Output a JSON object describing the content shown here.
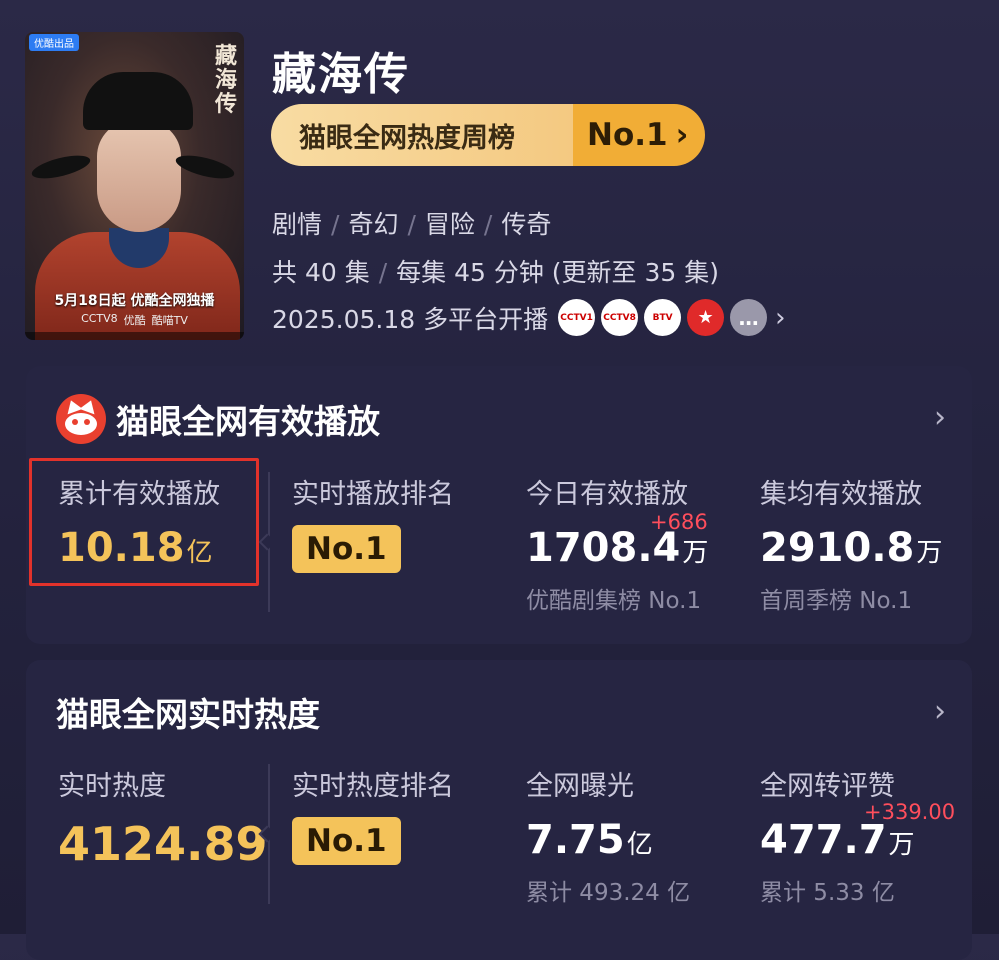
{
  "show": {
    "title": "藏海传",
    "poster": {
      "brand_tag": "优酷出品",
      "vertical_title": "藏海传",
      "date_text": "5月18日起 优酷全网独播",
      "platforms": [
        "CCTV8",
        "优酷",
        "酷喵TV"
      ]
    },
    "rank_pill": {
      "label": "猫眼全网热度周榜",
      "rank": "No.1",
      "chevron": "›"
    },
    "genres": [
      "剧情",
      "奇幻",
      "冒险",
      "传奇"
    ],
    "episodes": "共 40 集",
    "episode_detail": "每集 45 分钟 (更新至 35 集)",
    "air_date": "2025.05.18 多平台开播",
    "channel_logos": [
      "CCTV1",
      "CCTV8",
      "BTV",
      "东方",
      "…"
    ]
  },
  "card_play": {
    "title": "猫眼全网有效播放",
    "stats": [
      {
        "label": "累计有效播放",
        "value": "10.18",
        "unit": "亿"
      },
      {
        "label": "实时播放排名",
        "badge": "No.1"
      },
      {
        "label": "今日有效播放",
        "value": "1708.4",
        "unit": "万",
        "delta": "+686",
        "sub": "优酷剧集榜 No.1"
      },
      {
        "label": "集均有效播放",
        "value": "2910.8",
        "unit": "万",
        "sub": "首周季榜 No.1"
      }
    ]
  },
  "card_heat": {
    "title": "猫眼全网实时热度",
    "stats": [
      {
        "label": "实时热度",
        "value": "4124.89"
      },
      {
        "label": "实时热度排名",
        "badge": "No.1"
      },
      {
        "label": "全网曝光",
        "value": "7.75",
        "unit": "亿",
        "sub": "累计 493.24 亿"
      },
      {
        "label": "全网转评赞",
        "value": "477.7",
        "unit": "万",
        "delta": "+339.00",
        "sub": "累计 5.33 亿"
      }
    ]
  },
  "colors": {
    "accent_gold": "#f4c35a",
    "delta_red": "#ff4e5c",
    "highlight_red": "#e2322b",
    "brand_red": "#e9402f"
  }
}
